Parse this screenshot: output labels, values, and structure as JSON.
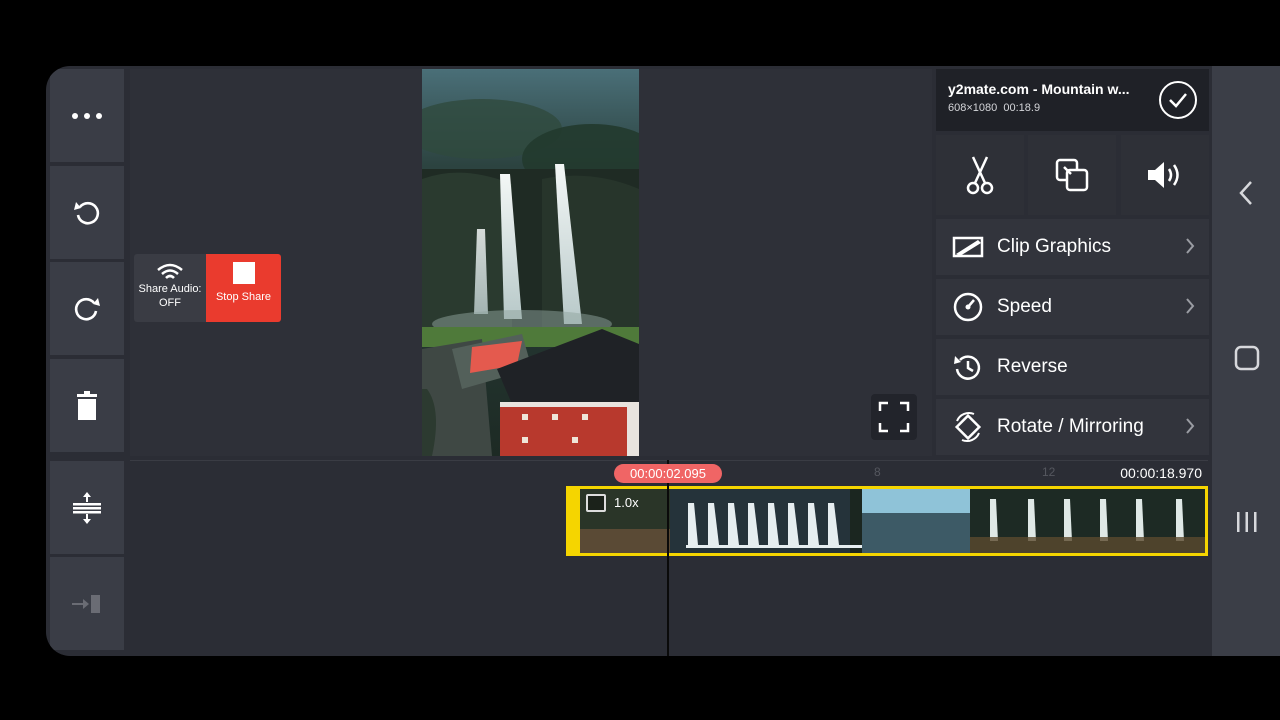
{
  "left_toolbar": {
    "icons": [
      "more-icon",
      "undo-icon",
      "redo-icon",
      "trash-icon",
      "timeline-adjust-icon",
      "insert-icon"
    ]
  },
  "share_widget": {
    "share_audio_label": "Share Audio:",
    "share_audio_state": "OFF",
    "stop_share_label": "Stop Share"
  },
  "clip": {
    "title": "y2mate.com - Mountain w...",
    "dimensions": "608×1080",
    "duration": "00:18.9"
  },
  "tools": [
    "scissors-icon",
    "layer-icon",
    "volume-icon"
  ],
  "menu": [
    {
      "label": "Clip Graphics",
      "icon": "clip-graphics-icon",
      "has_arrow": true
    },
    {
      "label": "Speed",
      "icon": "speed-icon",
      "has_arrow": true
    },
    {
      "label": "Reverse",
      "icon": "reverse-icon",
      "has_arrow": false
    },
    {
      "label": "Rotate / Mirroring",
      "icon": "rotate-icon",
      "has_arrow": true
    }
  ],
  "timeline": {
    "playhead_time": "00:00:02.095",
    "end_time": "00:00:18.970",
    "ticks": [
      "8",
      "12"
    ],
    "clip_speed": "1.0x"
  },
  "colors": {
    "background": "#2b2d35",
    "accent_yellow": "#f5d500",
    "playhead_red": "#f06565",
    "stop_share_red": "#ea3b2e"
  }
}
